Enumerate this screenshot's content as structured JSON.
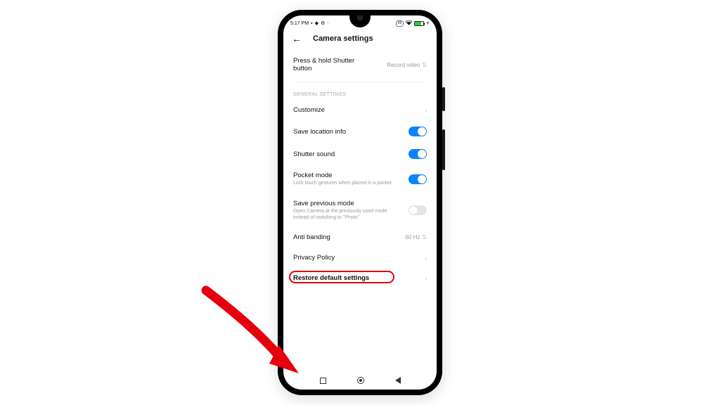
{
  "status_bar": {
    "time": "5:17 PM",
    "badge": "69"
  },
  "header": {
    "title": "Camera settings"
  },
  "rows": {
    "shutter_hold": {
      "label": "Press & hold Shutter button",
      "value": "Record video"
    },
    "section_general": "GENERAL SETTINGS",
    "customize": "Customize",
    "location": "Save location info",
    "shutter_sound": "Shutter sound",
    "pocket": {
      "title": "Pocket mode",
      "sub": "Lock touch gestures when placed in a pocket"
    },
    "save_prev": {
      "title": "Save previous mode",
      "sub": "Open Camera at the previously used mode instead of switching to \"Photo\""
    },
    "anti_banding": {
      "label": "Anti banding",
      "value": "60 Hz"
    },
    "privacy": "Privacy Policy",
    "restore": "Restore default settings"
  },
  "toggles": {
    "location": true,
    "shutter_sound": true,
    "pocket": true,
    "save_prev": false
  }
}
